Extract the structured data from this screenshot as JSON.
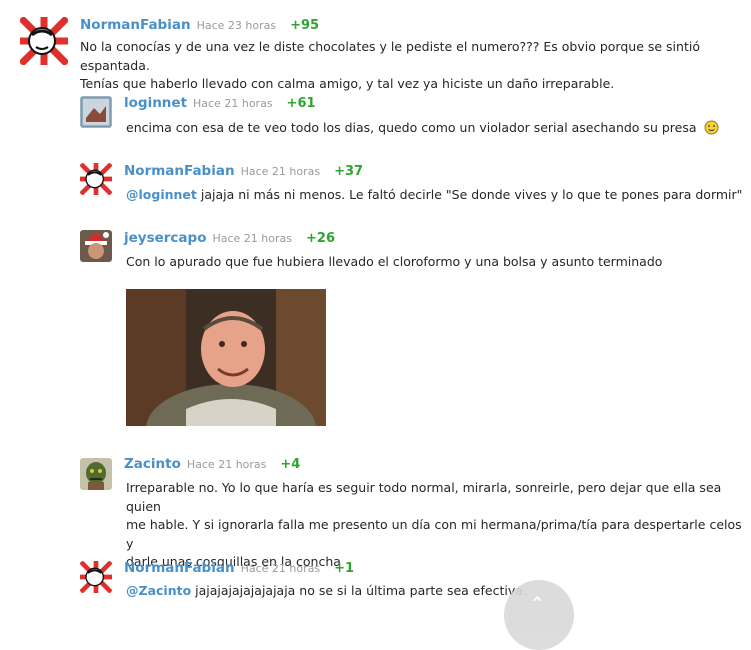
{
  "comments": [
    {
      "user": "NormanFabian",
      "time": "Hace 23 horas",
      "score": "+95",
      "line1": "No la conocías y de una vez le diste chocolates y le pediste el numero??? Es obvio porque se sintió espantada.",
      "line2": "Tenías que haberlo llevado con calma amigo, y tal vez ya hiciste un daño irreparable."
    },
    {
      "user": "loginnet",
      "time": "Hace 21 horas",
      "score": "+61",
      "text": "encima con esa de te veo todo los dias, quedo como un violador serial asechando su presa"
    },
    {
      "user": "NormanFabian",
      "time": "Hace 21 horas",
      "score": "+37",
      "mention": "@loginnet",
      "text": "jajaja ni más ni menos. Le faltó decirle \"Se donde vives y lo que te pones para dormir\""
    },
    {
      "user": "jeysercapo",
      "time": "Hace 21 horas",
      "score": "+26",
      "text": "Con lo apurado que fue hubiera llevado el cloroformo y una bolsa y asunto terminado"
    },
    {
      "user": "Zacinto",
      "time": "Hace 21 horas",
      "score": "+4",
      "line1": "Irreparable no. Yo lo que haría es seguir todo normal, mirarla, sonreirle, pero dejar que ella sea quien",
      "line2": "me hable. Y si ignorarla falla me presento un día con mi hermana/prima/tía para despertarle celos y",
      "line3": "darle unas cosquillas en la concha"
    },
    {
      "user": "NormanFabian",
      "time": "Hace 21 horas",
      "score": "+1",
      "mention": "@Zacinto",
      "text": "jajajajajajajajaja no se si la última parte sea efectiva."
    }
  ],
  "icons": {
    "emoji": "smiley-icon",
    "scroll": "chevron-up-icon"
  },
  "colors": {
    "username": "#4a90c8",
    "score": "#2ea52e",
    "time": "#9a9a9a"
  }
}
